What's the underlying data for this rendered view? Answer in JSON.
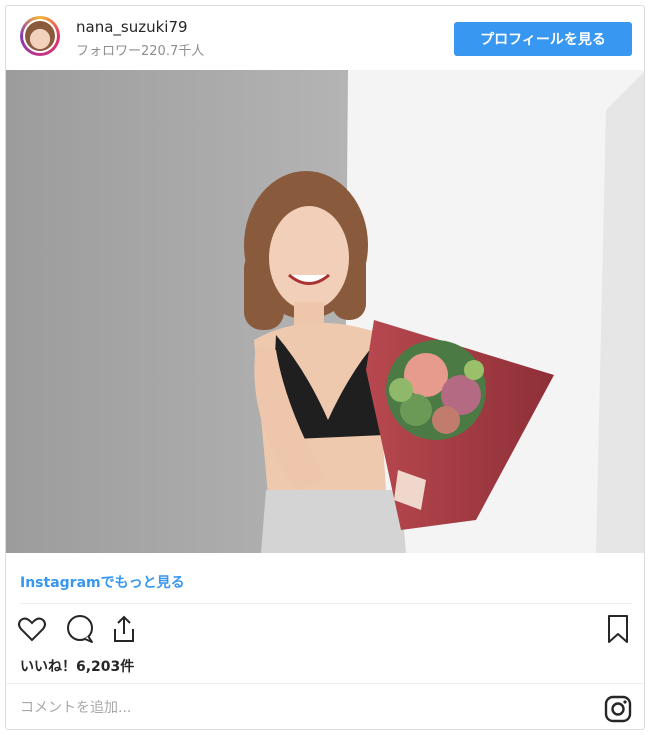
{
  "post": {
    "username": "nana_suzuki79",
    "followers": "フォロワー220.7千人",
    "profile_button": "プロフィールを見る",
    "more_link": "Instagramでもっと見る",
    "likes": "いいね！6,203件",
    "comment_placeholder": "コメントを追加..."
  },
  "icons": [
    "heart-icon",
    "comment-icon",
    "share-icon",
    "bookmark-icon",
    "instagram-icon"
  ],
  "colors": {
    "accent": "#3897f0",
    "text": "#262626",
    "muted": "#8e8e8e"
  }
}
